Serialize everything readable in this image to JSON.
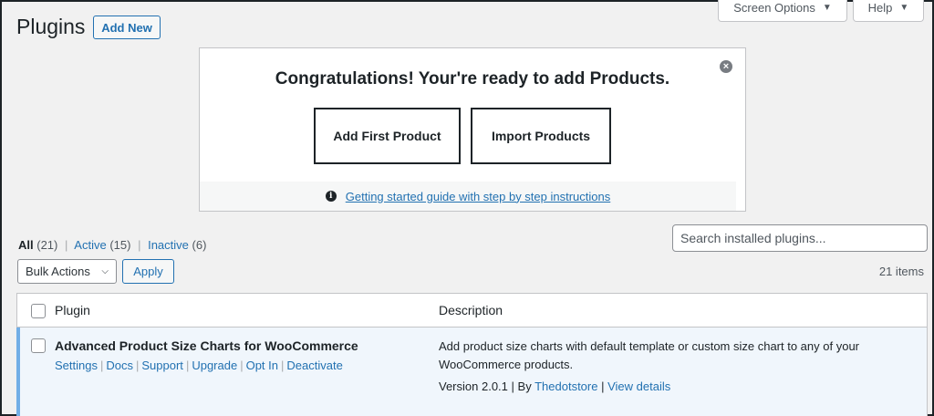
{
  "screen_meta": {
    "screen_options_label": "Screen Options",
    "help_label": "Help",
    "caret": "▼"
  },
  "header": {
    "title": "Plugins",
    "add_new_label": "Add New"
  },
  "notice": {
    "title": "Congratulations! Your're ready to add Products.",
    "close_glyph": "×",
    "primary_button": "Add First Product",
    "secondary_button": "Import Products",
    "info_glyph": "i",
    "guide_link": "Getting started guide with step by step instructions"
  },
  "filters": {
    "all_label": "All",
    "all_count": "(21)",
    "active_label": "Active",
    "active_count": "(15)",
    "inactive_label": "Inactive",
    "inactive_count": "(6)",
    "separator": "|"
  },
  "search": {
    "placeholder": "Search installed plugins..."
  },
  "bulk": {
    "select_label": "Bulk Actions",
    "apply_label": "Apply"
  },
  "items_count": "21 items",
  "table": {
    "col_plugin": "Plugin",
    "col_description": "Description",
    "row": {
      "name": "Advanced Product Size Charts for WooCommerce",
      "actions": [
        "Settings",
        "Docs",
        "Support",
        "Upgrade",
        "Opt In",
        "Deactivate"
      ],
      "description": "Add product size charts with default template or custom size chart to any of your WooCommerce products.",
      "version_text": "Version 2.0.1",
      "by_text": "By",
      "author": "Thedotstore",
      "view_details": "View details",
      "separator": "|"
    }
  },
  "colors": {
    "accent": "#2271b1",
    "active_row_border": "#72aee6",
    "active_row_bg": "#f0f6fc"
  }
}
